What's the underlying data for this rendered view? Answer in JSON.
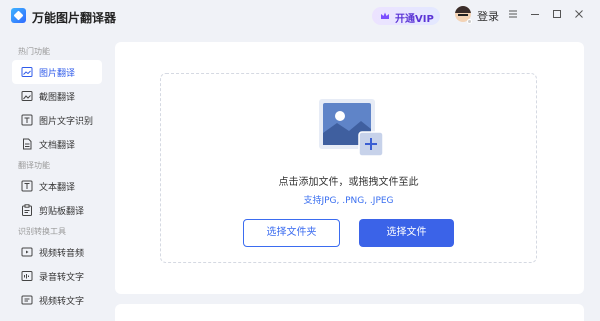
{
  "app": {
    "title": "万能图片翻译器",
    "logo_icon": "app-logo-icon"
  },
  "header": {
    "vip_label": "开通VIP",
    "login_label": "登录"
  },
  "sidebar": {
    "sections": [
      {
        "label": "热门功能",
        "items": [
          {
            "label": "图片翻译",
            "icon": "image-translate-icon",
            "active": true
          },
          {
            "label": "截图翻译",
            "icon": "screenshot-icon"
          },
          {
            "label": "图片文字识别",
            "icon": "ocr-icon"
          },
          {
            "label": "文档翻译",
            "icon": "document-icon"
          }
        ]
      },
      {
        "label": "翻译功能",
        "items": [
          {
            "label": "文本翻译",
            "icon": "text-icon"
          },
          {
            "label": "剪贴板翻译",
            "icon": "clipboard-icon"
          }
        ]
      },
      {
        "label": "识别转换工具",
        "items": [
          {
            "label": "视频转音频",
            "icon": "video-icon"
          },
          {
            "label": "录音转文字",
            "icon": "recording-icon"
          },
          {
            "label": "视频转文字",
            "icon": "video-text-icon"
          }
        ]
      }
    ]
  },
  "upload": {
    "hint": "点击添加文件，或拖拽文件至此",
    "formats": "支持JPG, .PNG, .JPEG",
    "folder_button": "选择文件夹",
    "file_button": "选择文件"
  },
  "colors": {
    "accent": "#3b63e8",
    "vip": "#5b34d6",
    "background": "#f0f2f7"
  }
}
